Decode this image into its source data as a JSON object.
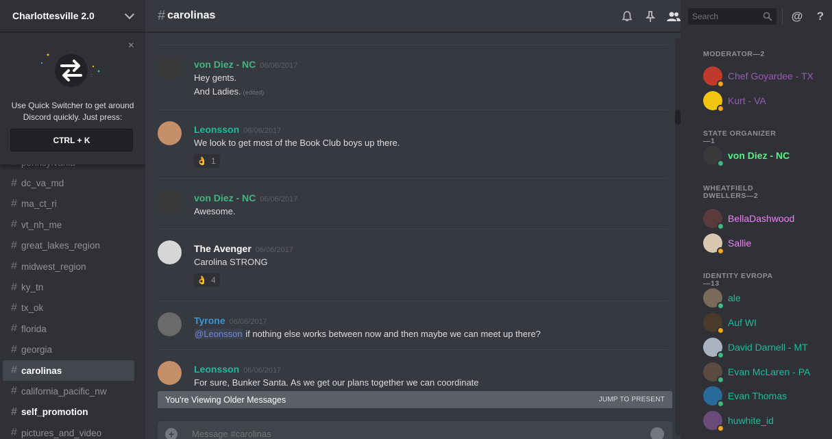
{
  "server": {
    "name": "Charlottesville 2.0"
  },
  "quick_switcher": {
    "close": "×",
    "text": "Use Quick Switcher to get around Discord quickly. Just press:",
    "shortcut": "CTRL + K"
  },
  "channels": [
    {
      "name": "pennsylvania",
      "state": "normal"
    },
    {
      "name": "dc_va_md",
      "state": "normal"
    },
    {
      "name": "ma_ct_ri",
      "state": "normal"
    },
    {
      "name": "vt_nh_me",
      "state": "normal"
    },
    {
      "name": "great_lakes_region",
      "state": "normal"
    },
    {
      "name": "midwest_region",
      "state": "normal"
    },
    {
      "name": "ky_tn",
      "state": "normal"
    },
    {
      "name": "tx_ok",
      "state": "normal"
    },
    {
      "name": "florida",
      "state": "normal"
    },
    {
      "name": "georgia",
      "state": "normal"
    },
    {
      "name": "carolinas",
      "state": "active"
    },
    {
      "name": "california_pacific_nw",
      "state": "normal"
    },
    {
      "name": "self_promotion",
      "state": "unread"
    },
    {
      "name": "pictures_and_video",
      "state": "normal"
    }
  ],
  "channel_header": {
    "hash": "#",
    "title": "carolinas"
  },
  "toolbar": {
    "search_placeholder": "Search",
    "at": "@",
    "help": "?"
  },
  "messages": [
    {
      "author": "von Diez - NC",
      "color": "#43b581",
      "time": "06/06/2017",
      "avatar": "#3a3a3a",
      "lines": [
        "Hey gents.",
        "And Ladies."
      ],
      "edited": "(edited)"
    },
    {
      "author": "Leonsson",
      "color": "#1abc9c",
      "time": "06/06/2017",
      "avatar": "#c58f6a",
      "lines": [
        "We look to get most of the Book Club boys up there."
      ],
      "reaction": {
        "emoji": "👌",
        "count": "1"
      }
    },
    {
      "author": "von Diez - NC",
      "color": "#43b581",
      "time": "06/06/2017",
      "avatar": "#3a3a3a",
      "lines": [
        "Awesome."
      ]
    },
    {
      "author": "The Avenger",
      "color": "#ffffff",
      "time": "06/06/2017",
      "avatar": "#d6d6d6",
      "lines": [
        "Carolina STRONG"
      ],
      "reaction": {
        "emoji": "👌",
        "count": "4"
      }
    },
    {
      "author": "Tyrone",
      "color": "#3498db",
      "time": "06/06/2017",
      "avatar": "#6a6a6a",
      "mention": "@Leonsson",
      "lines": [
        "if nothing else works between now and then maybe we can meet up there?"
      ]
    },
    {
      "author": "Leonsson",
      "color": "#1abc9c",
      "time": "06/06/2017",
      "avatar": "#c58f6a",
      "lines": [
        "For sure, Bunker Santa. As we get our plans together we can coordinate"
      ]
    }
  ],
  "older_bar": {
    "text": "You're Viewing Older Messages",
    "jump": "JUMP TO PRESENT"
  },
  "composer": {
    "placeholder": "Message #carolinas",
    "attach": "+"
  },
  "members": {
    "roles": [
      {
        "title": "MODERATOR—2",
        "members": [
          {
            "name": "Chef Goyardee - TX",
            "color": "#9b59b6",
            "status": "idle",
            "avatar": "#c0392b"
          },
          {
            "name": "Kurt - VA",
            "color": "#9b59b6",
            "status": "idle",
            "avatar": "#f1c40f"
          }
        ]
      },
      {
        "title": "STATE ORGANIZER—1",
        "members": [
          {
            "name": "von Diez - NC",
            "color": "#57f287",
            "status": "online",
            "avatar": "#3a3a3a",
            "bold": true
          }
        ]
      },
      {
        "title": "WHEATFIELD DWELLERS—2",
        "members": [
          {
            "name": "BellaDashwood",
            "color": "#f47fff",
            "status": "online",
            "avatar": "#5a3a3a"
          },
          {
            "name": "Sallie",
            "color": "#f47fff",
            "status": "idle",
            "avatar": "#d9c8b0"
          }
        ]
      },
      {
        "title": "IDENTITY EVROPA—13",
        "members": [
          {
            "name": "ale",
            "color": "#1abc9c",
            "status": "online",
            "avatar": "#7a6a5a"
          },
          {
            "name": "Auf WI",
            "color": "#1abc9c",
            "status": "idle",
            "avatar": "#4a3a2a"
          },
          {
            "name": "David Darnell - MT",
            "color": "#1abc9c",
            "status": "online",
            "avatar": "#aab4c0"
          },
          {
            "name": "Evan McLaren - PA",
            "color": "#1abc9c",
            "status": "online",
            "avatar": "#5a4a40"
          },
          {
            "name": "Evan Thomas",
            "color": "#1abc9c",
            "status": "online",
            "avatar": "#2a6a9a"
          },
          {
            "name": "huwhite_id",
            "color": "#1abc9c",
            "status": "idle",
            "avatar": "#6a4a7a"
          }
        ]
      }
    ]
  },
  "colors": {
    "online": "#43b581",
    "idle": "#faa61a"
  }
}
